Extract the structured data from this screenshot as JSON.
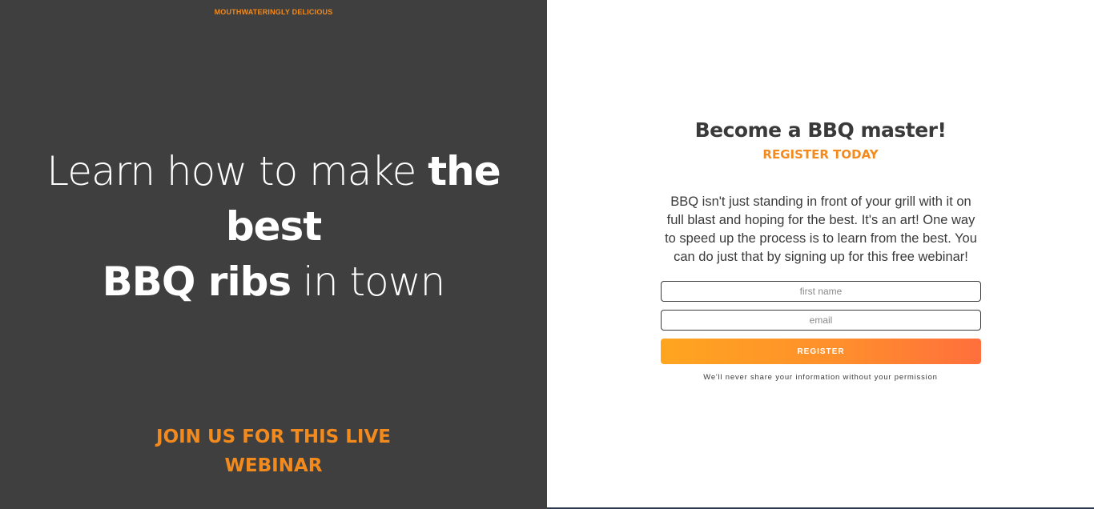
{
  "left_panel": {
    "tagline": "MOUTHWATERINGLY DELICIOUS",
    "headline": {
      "part1": "Learn how to make ",
      "bold1": "the best",
      "bold2": "BBQ ribs",
      "part2": " in town"
    },
    "cta_line1": "JOIN US FOR THIS LIVE",
    "cta_line2": "WEBINAR"
  },
  "right_panel": {
    "title": "Become a BBQ master!",
    "subtitle": "REGISTER TODAY",
    "description": "BBQ isn't just standing in front of your grill with it on full blast and hoping for the best. It's an art! One way to speed up the process is to learn from the best. You can do just that by signing up for this free webinar!",
    "form": {
      "first_name_placeholder": "first name",
      "first_name_value": "",
      "email_placeholder": "email",
      "email_value": "",
      "register_label": "REGISTER"
    },
    "privacy_note": "We'll never share your information without your permission"
  },
  "colors": {
    "left_bg": "#3f3f3f",
    "accent": "#f28a1e",
    "button_gradient_start": "#ffa51f",
    "button_gradient_end": "#ff6f3c",
    "text_dark": "#3a3a3a"
  }
}
